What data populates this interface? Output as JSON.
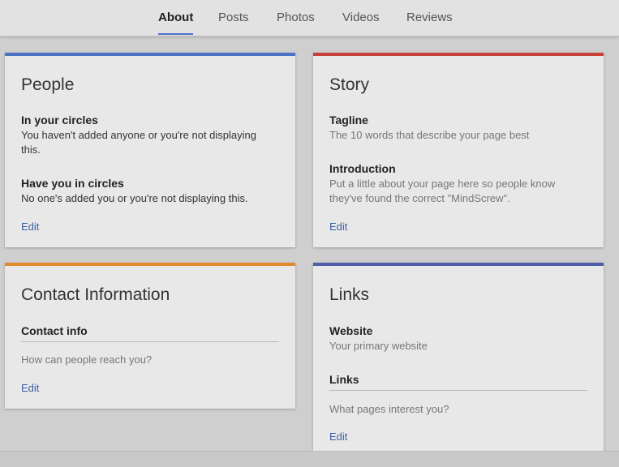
{
  "tabs": [
    {
      "label": "About",
      "active": true
    },
    {
      "label": "Posts",
      "active": false
    },
    {
      "label": "Photos",
      "active": false
    },
    {
      "label": "Videos",
      "active": false
    },
    {
      "label": "Reviews",
      "active": false
    }
  ],
  "cards": {
    "people": {
      "accent": "#4a73c8",
      "title": "People",
      "in_circles_label": "In your circles",
      "in_circles_desc": "You haven't added anyone or you're not displaying this.",
      "have_you_label": "Have you in circles",
      "have_you_desc": "No one's added you or you're not displaying this.",
      "edit": "Edit"
    },
    "story": {
      "accent": "#c8423a",
      "title": "Story",
      "tagline_label": "Tagline",
      "tagline_desc": "The 10 words that describe your page best",
      "intro_label": "Introduction",
      "intro_desc": "Put a little about your page here so people know they've found the correct \"MindScrew\".",
      "edit": "Edit"
    },
    "contact": {
      "accent": "#e08a2e",
      "title": "Contact Information",
      "contact_label": "Contact info",
      "contact_placeholder": "How can people reach you?",
      "edit": "Edit"
    },
    "links": {
      "accent": "#4e5fa8",
      "title": "Links",
      "website_label": "Website",
      "website_desc": "Your primary website",
      "links_label": "Links",
      "links_placeholder": "What pages interest you?",
      "edit": "Edit"
    }
  }
}
